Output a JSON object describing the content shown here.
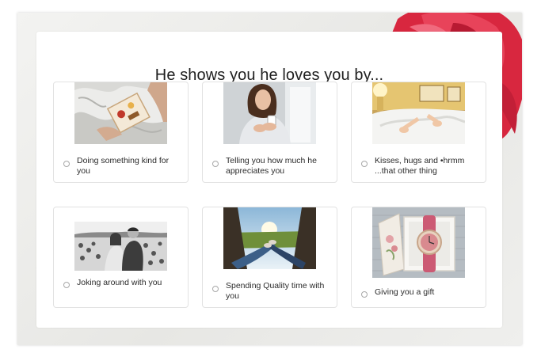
{
  "quiz": {
    "question": "He shows you he loves you by...",
    "options": [
      {
        "label": "Doing something kind for you",
        "image": "breakfast-in-bed"
      },
      {
        "label": "Telling you how much he appreciates you",
        "image": "woman-with-phone"
      },
      {
        "label": "Kisses, hugs and •hrmm ...that other thing",
        "image": "bed-feet"
      },
      {
        "label": "Joking around with you",
        "image": "couple-laughing"
      },
      {
        "label": "Spending Quality time with you",
        "image": "feet-from-car"
      },
      {
        "label": "Giving you a gift",
        "image": "watch-in-box"
      }
    ]
  },
  "colors": {
    "accent_flower": "#d8273f",
    "card_border": "#e2e2e2",
    "text": "#1f1f1f"
  }
}
